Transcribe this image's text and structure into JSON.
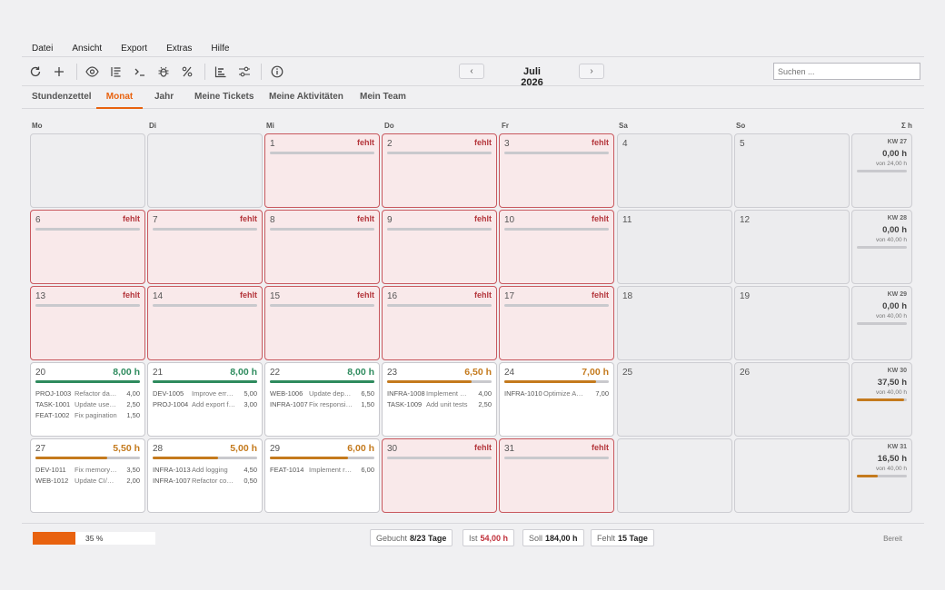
{
  "menu": [
    "Datei",
    "Ansicht",
    "Export",
    "Extras",
    "Hilfe"
  ],
  "toolbar": {
    "month": "Juli 2026",
    "prev": "‹",
    "next": "›",
    "search_placeholder": "Suchen ..."
  },
  "tabs": [
    "Stundenzettel",
    "Monat",
    "Jahr",
    "Meine Tickets",
    "Meine Aktivitäten",
    "Mein Team"
  ],
  "active_tab": "Monat",
  "weekdays": [
    "Mo",
    "Di",
    "Mi",
    "Do",
    "Fr",
    "Sa",
    "So",
    "Σ h"
  ],
  "colors": {
    "accent": "#e8620f",
    "missing": "#b4363c",
    "full": "#2e8b5e",
    "partial": "#c47a1d"
  },
  "status_missing": "fehlt",
  "weeks": [
    {
      "days": [
        {
          "type": "empty"
        },
        {
          "type": "empty"
        },
        {
          "type": "missing",
          "day": "1"
        },
        {
          "type": "missing",
          "day": "2"
        },
        {
          "type": "missing",
          "day": "3"
        },
        {
          "type": "weekend",
          "day": "4"
        },
        {
          "type": "weekend",
          "day": "5"
        }
      ],
      "summary": {
        "kw": "KW 27",
        "sum": "0,00 h",
        "soll": "von 24,00 h",
        "progress": 0
      }
    },
    {
      "days": [
        {
          "type": "missing",
          "day": "6"
        },
        {
          "type": "missing",
          "day": "7"
        },
        {
          "type": "missing",
          "day": "8"
        },
        {
          "type": "missing",
          "day": "9"
        },
        {
          "type": "missing",
          "day": "10"
        },
        {
          "type": "weekend",
          "day": "11"
        },
        {
          "type": "weekend",
          "day": "12"
        }
      ],
      "summary": {
        "kw": "KW 28",
        "sum": "0,00 h",
        "soll": "von 40,00 h",
        "progress": 0
      }
    },
    {
      "days": [
        {
          "type": "missing",
          "day": "13"
        },
        {
          "type": "missing",
          "day": "14"
        },
        {
          "type": "missing",
          "day": "15"
        },
        {
          "type": "missing",
          "day": "16"
        },
        {
          "type": "missing",
          "day": "17"
        },
        {
          "type": "weekend",
          "day": "18"
        },
        {
          "type": "weekend",
          "day": "19"
        }
      ],
      "summary": {
        "kw": "KW 29",
        "sum": "0,00 h",
        "soll": "von 40,00 h",
        "progress": 0
      }
    },
    {
      "days": [
        {
          "type": "work",
          "day": "20",
          "hours": "8,00 h",
          "level": "full",
          "progress": 1.0,
          "entries": [
            {
              "ticket": "PROJ-1003",
              "desc": "Refactor database",
              "hours": "4,00"
            },
            {
              "ticket": "TASK-1001",
              "desc": "Update user docs",
              "hours": "2,50"
            },
            {
              "ticket": "FEAT-1002",
              "desc": "Fix pagination",
              "hours": "1,50"
            }
          ]
        },
        {
          "type": "work",
          "day": "21",
          "hours": "8,00 h",
          "level": "full",
          "progress": 1.0,
          "entries": [
            {
              "ticket": "DEV-1005",
              "desc": "Improve error handling",
              "hours": "5,00"
            },
            {
              "ticket": "PROJ-1004",
              "desc": "Add export feature",
              "hours": "3,00"
            }
          ]
        },
        {
          "type": "work",
          "day": "22",
          "hours": "8,00 h",
          "level": "full",
          "progress": 1.0,
          "entries": [
            {
              "ticket": "WEB-1006",
              "desc": "Update dependencies",
              "hours": "6,50"
            },
            {
              "ticket": "INFRA-1007",
              "desc": "Fix responsive layout",
              "hours": "1,50"
            }
          ]
        },
        {
          "type": "work",
          "day": "23",
          "hours": "6,50 h",
          "level": "partial",
          "progress": 0.81,
          "entries": [
            {
              "ticket": "INFRA-1008",
              "desc": "Implement caching",
              "hours": "4,00"
            },
            {
              "ticket": "TASK-1009",
              "desc": "Add unit tests",
              "hours": "2,50"
            }
          ]
        },
        {
          "type": "work",
          "day": "24",
          "hours": "7,00 h",
          "level": "partial",
          "progress": 0.875,
          "entries": [
            {
              "ticket": "INFRA-1010",
              "desc": "Optimize API calls",
              "hours": "7,00"
            }
          ]
        },
        {
          "type": "weekend",
          "day": "25"
        },
        {
          "type": "weekend",
          "day": "26"
        }
      ],
      "summary": {
        "kw": "KW 30",
        "sum": "37,50 h",
        "soll": "von 40,00 h",
        "progress": 0.94
      }
    },
    {
      "days": [
        {
          "type": "work",
          "day": "27",
          "hours": "5,50 h",
          "level": "partial",
          "progress": 0.69,
          "entries": [
            {
              "ticket": "DEV-1011",
              "desc": "Fix memory leak",
              "hours": "3,50"
            },
            {
              "ticket": "WEB-1012",
              "desc": "Update CI/CD pipeline",
              "hours": "2,00"
            }
          ]
        },
        {
          "type": "work",
          "day": "28",
          "hours": "5,00 h",
          "level": "partial",
          "progress": 0.63,
          "entries": [
            {
              "ticket": "INFRA-1013",
              "desc": "Add logging",
              "hours": "4,50"
            },
            {
              "ticket": "INFRA-1007",
              "desc": "Refactor components",
              "hours": "0,50"
            }
          ]
        },
        {
          "type": "work",
          "day": "29",
          "hours": "6,00 h",
          "level": "partial",
          "progress": 0.75,
          "entries": [
            {
              "ticket": "FEAT-1014",
              "desc": "Implement retry logic",
              "hours": "6,00"
            }
          ]
        },
        {
          "type": "missing",
          "day": "30"
        },
        {
          "type": "missing",
          "day": "31"
        },
        {
          "type": "empty"
        },
        {
          "type": "empty"
        }
      ],
      "summary": {
        "kw": "KW 31",
        "sum": "16,50 h",
        "soll": "von 40,00 h",
        "progress": 0.41
      }
    }
  ],
  "statusbar": {
    "progress": 0.35,
    "progress_label": "35 %",
    "gebucht_label": "Gebucht",
    "gebucht_value": "8/23 Tage",
    "ist_label": "Ist",
    "ist_value": "54,00 h",
    "soll_label": "Soll",
    "soll_value": "184,00 h",
    "fehlt_label": "Fehlt",
    "fehlt_value": "15 Tage",
    "ready": "Bereit"
  }
}
